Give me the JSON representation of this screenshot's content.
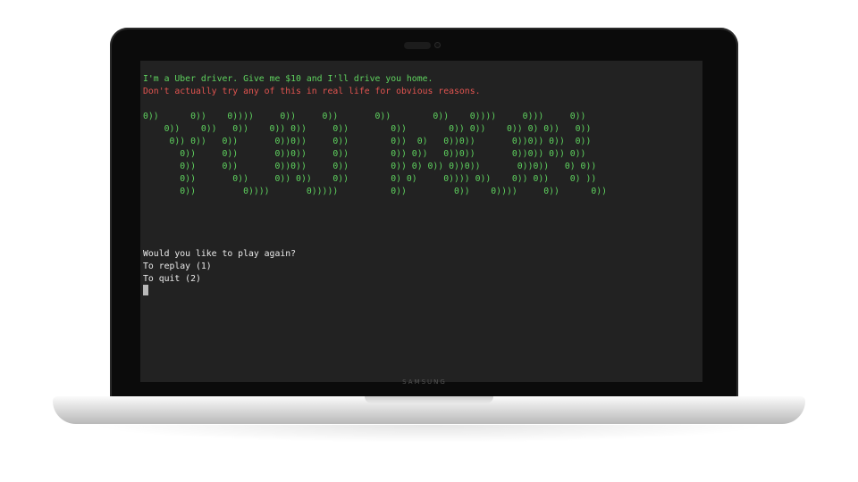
{
  "terminal": {
    "intro_line": "I'm a Uber driver. Give me $10 and I'll drive you home.",
    "warning_line": "Don't actually try any of this in real life for obvious reasons.",
    "ascii_art": [
      "0))      0))    0))))     0))     0))       0))        0))    0))))     0)))     0))",
      "    0))    0))   0))    0)) 0))     0))        0))        0)) 0))    0)) 0) 0))   0))",
      "     0)) 0))   0))       0))0))     0))        0))  0)   0))0))       0))0)) 0))  0))",
      "       0))     0))       0))0))     0))        0)) 0))   0))0))       0))0)) 0)) 0))",
      "       0))     0))       0))0))     0))        0)) 0) 0)) 0))0))       0))0))   0) 0))",
      "       0))       0))     0)) 0))    0))        0) 0)     0)))) 0))    0)) 0))    0) ))",
      "       0))         0))))       0)))))          0))         0))    0))))     0))      0))"
    ],
    "prompt_question": "Would you like to play again?",
    "option_replay": "To replay (1)",
    "option_quit": "To quit (2)"
  },
  "device": {
    "brand_text": "SAMSUNG"
  },
  "colors": {
    "terminal_bg": "#222222",
    "green_text": "#5fd35f",
    "red_text": "#e25450",
    "white_text": "#eaeaea"
  }
}
